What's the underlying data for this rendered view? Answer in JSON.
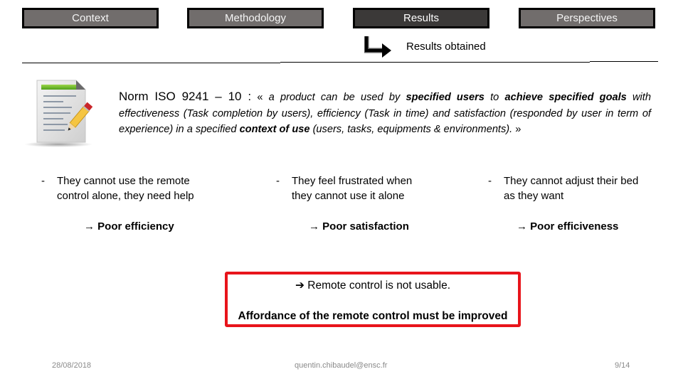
{
  "nav": {
    "tabs": [
      {
        "label": "Context",
        "active": false
      },
      {
        "label": "Methodology",
        "active": false
      },
      {
        "label": "Results",
        "active": true
      },
      {
        "label": "Perspectives",
        "active": false
      }
    ],
    "sub_section": "Results obtained"
  },
  "colors": {
    "tab_inactive": "#716d6c",
    "tab_active": "#3b3938",
    "highlight_border": "#e8141b"
  },
  "norm": {
    "lead": "Norm ISO 9241 – 10 :",
    "open_quote": "«",
    "p1": "a product can be used by",
    "b1": "specified users",
    "p2": "to",
    "b2": "achieve specified goals",
    "p3": "with effectiveness (Task completion by users), efficiency (Task in time) and satisfaction (responded by user in term of experience) in a specified",
    "b3": "context of use",
    "p4": "(users, tasks, equipments & environments).",
    "close_quote": "»"
  },
  "findings": [
    {
      "dash": "-",
      "line1": "They cannot use the remote",
      "line2": "control alone, they need help",
      "result": "Poor efficiency"
    },
    {
      "dash": "-",
      "line1": "They feel frustrated when",
      "line2": "they cannot use it alone",
      "result": "Poor satisfaction"
    },
    {
      "dash": "-",
      "line1": "They cannot adjust their bed",
      "line2": "as they want",
      "result": "Poor efficiveness"
    }
  ],
  "arrow_glyph": "→",
  "conclusion": {
    "arrow": "➔",
    "line1": "Remote control is not usable.",
    "line2": "Affordance of the remote control must be improved"
  },
  "footer": {
    "date": "28/08/2018",
    "email": "quentin.chibaudel@ensc.fr",
    "page": "9/14"
  }
}
